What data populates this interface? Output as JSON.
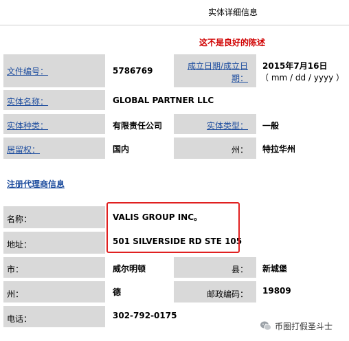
{
  "header": {
    "title": "实体详细信息"
  },
  "warning": "这不是良好的陈述",
  "entity": {
    "file_no_label": "文件编号：",
    "file_no": "5786769",
    "inc_date_label_1": "成立日期/成立日",
    "inc_date_label_2": "期：",
    "inc_date": "2015年7月16日",
    "inc_date_format": "（ mm / dd / yyyy ）",
    "name_label": "实体名称：",
    "name": "GLOBAL PARTNER LLC",
    "kind_label": "实体种类：",
    "kind": "有限责任公司",
    "type_label": "实体类型：",
    "type": "一般",
    "residence_label": "居留权：",
    "residence": "国内",
    "state_label": "州：",
    "state": "特拉华州"
  },
  "agent": {
    "section_title": "注册代理商信息",
    "name_label": "名称：",
    "name": "VALIS GROUP INC。",
    "address_label": "地址：",
    "address": "501 SILVERSIDE RD STE 105",
    "city_label": "市：",
    "city": "威尔明顿",
    "county_label": "县：",
    "county": "新城堡",
    "state_label": "州：",
    "state": "德",
    "zip_label": "邮政编码：",
    "zip": "19809",
    "phone_label": "电话：",
    "phone": "302-792-0175"
  },
  "watermark": {
    "icon": "wechat-icon",
    "text": "币圈打假圣斗士"
  },
  "colors": {
    "label_bg": "#d9d9d9",
    "link": "#1f4e9f",
    "warning": "#d00000",
    "highlight_border": "#e02020"
  }
}
